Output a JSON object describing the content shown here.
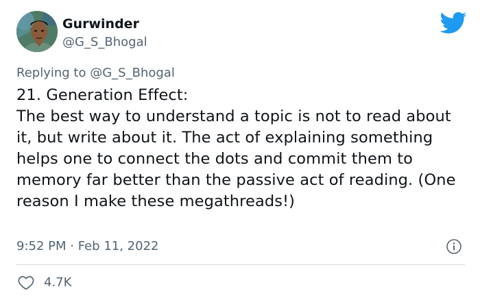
{
  "author": {
    "display_name": "Gurwinder",
    "handle": "@G_S_Bhogal"
  },
  "replying": {
    "prefix": "Replying to",
    "mention": "@G_S_Bhogal"
  },
  "tweet": {
    "text": "21. Generation Effect:\nThe best way to understand a topic is not to read about it, but write about it. The act of explaining something helps one to connect the dots and commit them to memory far better than the passive act of reading. (One reason I make these megathreads!)",
    "time": "9:52 PM",
    "separator": "·",
    "date": "Feb 11, 2022"
  },
  "stats": {
    "likes": "4.7K"
  },
  "icons": {
    "brand": "twitter-bird-icon",
    "info": "info-icon",
    "like": "heart-icon"
  },
  "colors": {
    "brand_blue": "#1d9bf0",
    "secondary_text": "#536471",
    "primary_text": "#0f1419",
    "divider": "#cfd9de"
  }
}
